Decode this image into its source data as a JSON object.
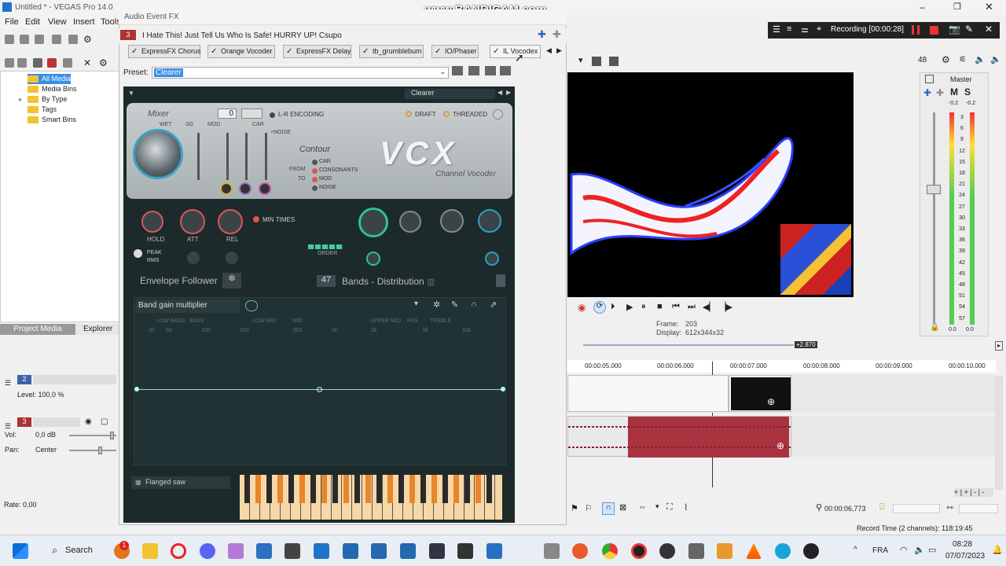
{
  "window": {
    "title": "Untitled * - VEGAS Pro 14.0"
  },
  "watermark": "www.BANDICAM.com",
  "menu": [
    "File",
    "Edit",
    "View",
    "Insert",
    "Tools"
  ],
  "tree": {
    "items": [
      "All Media",
      "Media Bins",
      "By Type",
      "Tags",
      "Smart Bins"
    ]
  },
  "left_tabs": [
    "Project Media",
    "Explorer"
  ],
  "tracks": {
    "video": {
      "number": "2",
      "level": "Level: 100,0 %"
    },
    "audio": {
      "number": "3",
      "vol_label": "Vol:",
      "vol": "0,0 dB",
      "pan_label": "Pan:",
      "pan": "Center"
    },
    "rate": "Rate: 0,00"
  },
  "fx": {
    "window_title": "Audio Event FX",
    "track_number": "3",
    "chain_title": "I Hate This! Just Tell Us Who Is Safe! HURRY UP! Csupo",
    "tabs": [
      "ExpressFX Chorus",
      "Orange Vocoder",
      "ExpressFX Delay",
      "tb_grumblebum",
      "IO/Phaser",
      "IL Vocodex"
    ],
    "preset_label": "Preset:",
    "preset_value": "Clearer"
  },
  "plugin": {
    "preset_name": "Clearer",
    "mixer": "Mixer",
    "mixer_value": "0",
    "wet": "WET",
    "sg": "SG",
    "mod": "MOD",
    "car": "CAR",
    "noise": "+NOISE",
    "lr": "L-R ENCODING",
    "draft": "DRAFT",
    "threaded": "THREADED",
    "logo": "VCX",
    "subtitle": "Channel Vocoder",
    "contour": "Contour",
    "contour_opts": [
      "CAR",
      "CONSONANTS",
      "MOD",
      "NOISE"
    ],
    "from": "FROM",
    "to": "TO",
    "hold": "HOLD",
    "att": "ATT",
    "rel": "REL",
    "min_times": "MIN TIMES",
    "peak": "PEAK",
    "rms": "RMS",
    "order": "ORDER",
    "envelope": "Envelope Follower",
    "bands_value": "47",
    "bands_label": "Bands - Distribution",
    "band_gain": "Band gain multiplier",
    "freq_labels": [
      "LOW BASS",
      "BASS",
      "LOW MID",
      "MID",
      "UPPER MID",
      "PAS",
      "TREBLE"
    ],
    "freq_ticks": [
      "20",
      "50",
      "100",
      "200",
      "500",
      "1k",
      "2k",
      "5k",
      "10k"
    ],
    "synth": "Flanged saw"
  },
  "preview": {
    "frame_label": "Frame:",
    "frame": "203",
    "display_label": "Display:",
    "display": "612x344x32"
  },
  "master": {
    "label": "Master",
    "m": "M",
    "s": "S",
    "peaks": [
      "-0.2",
      "-0.2"
    ],
    "scale": [
      "3",
      "6",
      "9",
      "12",
      "15",
      "18",
      "21",
      "24",
      "27",
      "30",
      "33",
      "36",
      "39",
      "42",
      "45",
      "48",
      "51",
      "54",
      "57"
    ],
    "bottom": [
      "0.0",
      "0.0"
    ],
    "top_val": "48"
  },
  "timeline": {
    "marker": "+2.870",
    "times": [
      "00:00:05.000",
      "00:00:06.000",
      "00:00:07.000",
      "00:00:08.000",
      "00:00:09.000",
      "00:00:10.000"
    ],
    "position": "00:00:06,773",
    "record_time": "Record Time (2 channels): 118:19:45"
  },
  "recorder": {
    "status": "Recording [00:00:28]"
  },
  "taskbar": {
    "search": "Search",
    "lang": "FRA",
    "time": "08:28",
    "date": "07/07/2023",
    "badge": "1"
  }
}
